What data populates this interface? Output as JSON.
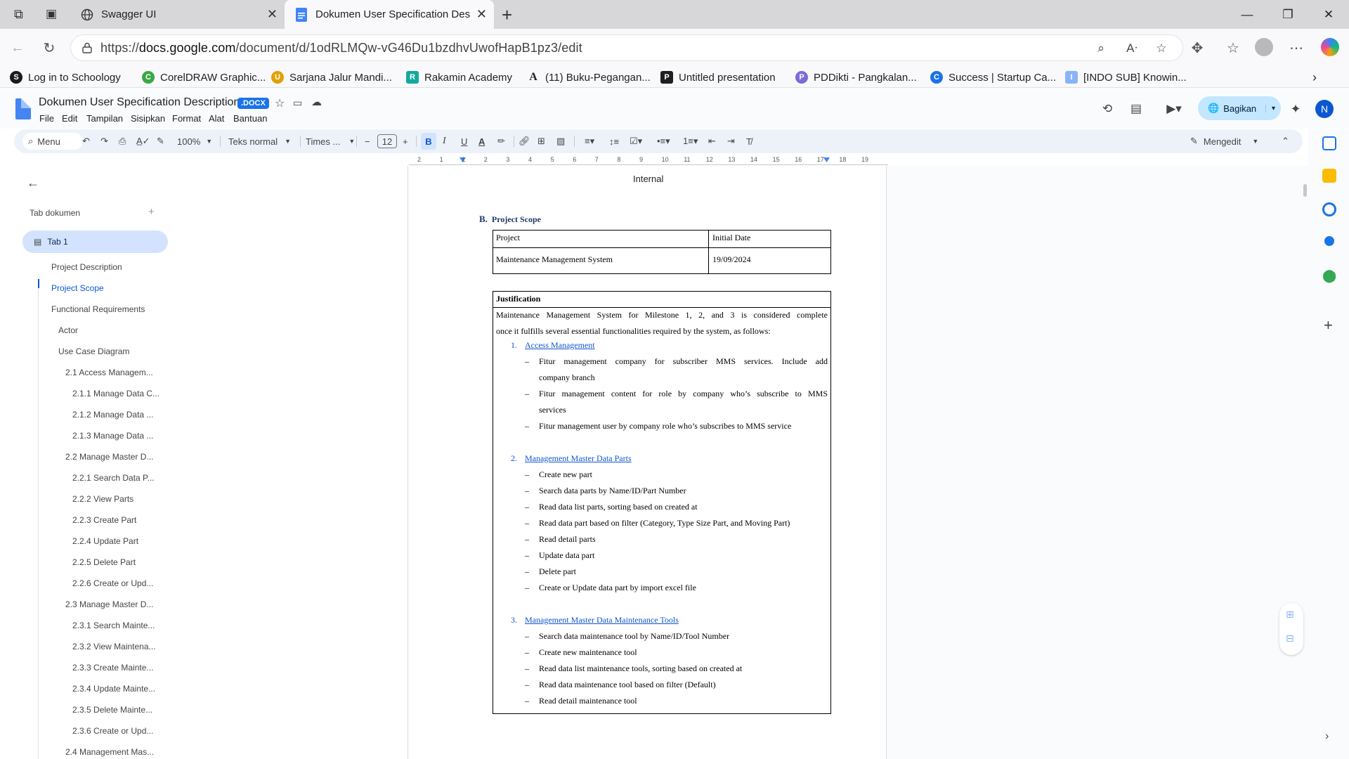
{
  "browser": {
    "tabs": [
      {
        "title": "Swagger UI",
        "icon": "globe-icon"
      },
      {
        "title": "Dokumen User Specification Desc",
        "icon": "docs-icon"
      }
    ],
    "url_prefix": "https://",
    "url_host": "docs.google.com",
    "url_path": "/document/d/1odRLMQw-vG46Du1bzdhvUwofHapB1pz3/edit",
    "bookmarks": [
      {
        "label": "Log in to Schoology",
        "icon": "S",
        "color": "#1a1a1a"
      },
      {
        "label": "CorelDRAW Graphic...",
        "icon": "C",
        "color": "#3aa845"
      },
      {
        "label": "Sarjana Jalur Mandi...",
        "icon": "U",
        "color": "#e0a100"
      },
      {
        "label": "Rakamin Academy",
        "icon": "R",
        "color": "#15a89c"
      },
      {
        "label": "(11) Buku-Pegangan...",
        "icon": "A",
        "color": "#1f1f1f"
      },
      {
        "label": "Untitled presentation",
        "icon": "P",
        "color": "#1f1f1f"
      },
      {
        "label": "PDDikti - Pangkalan...",
        "icon": "P",
        "color": "#7b6cd9"
      },
      {
        "label": "Success | Startup Ca...",
        "icon": "C",
        "color": "#1a73e8"
      },
      {
        "label": "[INDO SUB] Knowin...",
        "icon": "I",
        "color": "#8ab4f8"
      }
    ]
  },
  "docs": {
    "title": "Dokumen User Specification Description",
    "badge": ".DOCX",
    "menus": [
      "File",
      "Edit",
      "Tampilan",
      "Sisipkan",
      "Format",
      "Alat",
      "Bantuan"
    ],
    "share_label": "Bagikan",
    "avatar_initial": "N",
    "toolbar": {
      "search_label": "Menu",
      "zoom": "100%",
      "style": "Teks normal",
      "font": "Times ...",
      "font_size": "12",
      "mode": "Mengedit"
    }
  },
  "ruler_ticks": [
    "2",
    "1",
    "1",
    "2",
    "3",
    "4",
    "5",
    "6",
    "7",
    "8",
    "9",
    "10",
    "11",
    "12",
    "13",
    "14",
    "15",
    "16",
    "17",
    "18",
    "19"
  ],
  "outline": {
    "header": "Tab dokumen",
    "tab": "Tab 1",
    "items": [
      {
        "label": "Project Description",
        "level": 1,
        "active": false
      },
      {
        "label": "Project Scope",
        "level": 1,
        "active": true
      },
      {
        "label": "Functional Requirements",
        "level": 1,
        "active": false
      },
      {
        "label": "Actor",
        "level": 2,
        "active": false
      },
      {
        "label": "Use Case Diagram",
        "level": 2,
        "active": false
      },
      {
        "label": "2.1 Access Managem...",
        "level": 3,
        "active": false
      },
      {
        "label": "2.1.1 Manage Data C...",
        "level": 4,
        "active": false
      },
      {
        "label": "2.1.2 Manage Data ...",
        "level": 4,
        "active": false
      },
      {
        "label": "2.1.3 Manage Data ...",
        "level": 4,
        "active": false
      },
      {
        "label": "2.2 Manage Master D...",
        "level": 3,
        "active": false
      },
      {
        "label": "2.2.1 Search Data P...",
        "level": 4,
        "active": false
      },
      {
        "label": "2.2.2 View Parts",
        "level": 4,
        "active": false
      },
      {
        "label": "2.2.3 Create Part",
        "level": 4,
        "active": false
      },
      {
        "label": "2.2.4 Update Part",
        "level": 4,
        "active": false
      },
      {
        "label": "2.2.5 Delete Part",
        "level": 4,
        "active": false
      },
      {
        "label": "2.2.6 Create or Upd...",
        "level": 4,
        "active": false
      },
      {
        "label": "2.3 Manage Master D...",
        "level": 3,
        "active": false
      },
      {
        "label": "2.3.1 Search Mainte...",
        "level": 4,
        "active": false
      },
      {
        "label": "2.3.2 View Maintena...",
        "level": 4,
        "active": false
      },
      {
        "label": "2.3.3 Create Mainte...",
        "level": 4,
        "active": false
      },
      {
        "label": "2.3.4 Update Mainte...",
        "level": 4,
        "active": false
      },
      {
        "label": "2.3.5 Delete Mainte...",
        "level": 4,
        "active": false
      },
      {
        "label": "2.3.6 Create or Upd...",
        "level": 4,
        "active": false
      },
      {
        "label": "2.4 Management Mas...",
        "level": 3,
        "active": false
      }
    ]
  },
  "document": {
    "header_text": "Internal",
    "section_letter": "B.",
    "section_title": "Project Scope",
    "scope_table": {
      "headers": [
        "Project",
        "Initial Date"
      ],
      "row": [
        "Maintenance Management System",
        "19/09/2024"
      ]
    },
    "justification": {
      "heading": "Justification",
      "intro_line1": "Maintenance Management System for Milestone 1, 2, and 3 is considered complete",
      "intro_line2": "once it fulfills several essential functionalities required by the system, as follows:",
      "sections": [
        {
          "number": "1.",
          "title": "Access Management",
          "lines": [
            {
              "dash": true,
              "text": "Fitur management company for subscriber MMS services. Include add"
            },
            {
              "dash": false,
              "text": "company branch"
            },
            {
              "dash": true,
              "text": "Fitur management content for role by company who’s subscribe to MMS"
            },
            {
              "dash": false,
              "text": "services"
            },
            {
              "dash": true,
              "text": "Fitur management user by company role who’s subscribes to MMS service"
            }
          ]
        },
        {
          "number": "2.",
          "title": "Management Master Data Parts",
          "lines": [
            {
              "dash": true,
              "text": "Create new part"
            },
            {
              "dash": true,
              "text": "Search data parts by Name/ID/Part Number"
            },
            {
              "dash": true,
              "text": "Read data list parts, sorting based on created at"
            },
            {
              "dash": true,
              "text": "Read data part based on filter (Category, Type Size Part, and Moving Part)"
            },
            {
              "dash": true,
              "text": "Read detail parts"
            },
            {
              "dash": true,
              "text": "Update data part"
            },
            {
              "dash": true,
              "text": "Delete part"
            },
            {
              "dash": true,
              "text": "Create or Update data part by import excel file"
            }
          ]
        },
        {
          "number": "3.",
          "title": "Management Master Data Maintenance Tools",
          "lines": [
            {
              "dash": true,
              "text": "Search data maintenance tool by Name/ID/Tool Number"
            },
            {
              "dash": true,
              "text": "Create new maintenance tool"
            },
            {
              "dash": true,
              "text": "Read data list maintenance tools, sorting based on created at"
            },
            {
              "dash": true,
              "text": "Read data maintenance tool based on filter (Default)"
            },
            {
              "dash": true,
              "text": "Read detail maintenance tool"
            }
          ]
        }
      ]
    }
  },
  "colors": {
    "accent": "#1a73e8",
    "heading_blue": "#1f3864",
    "share_bg": "#c2e7ff"
  }
}
